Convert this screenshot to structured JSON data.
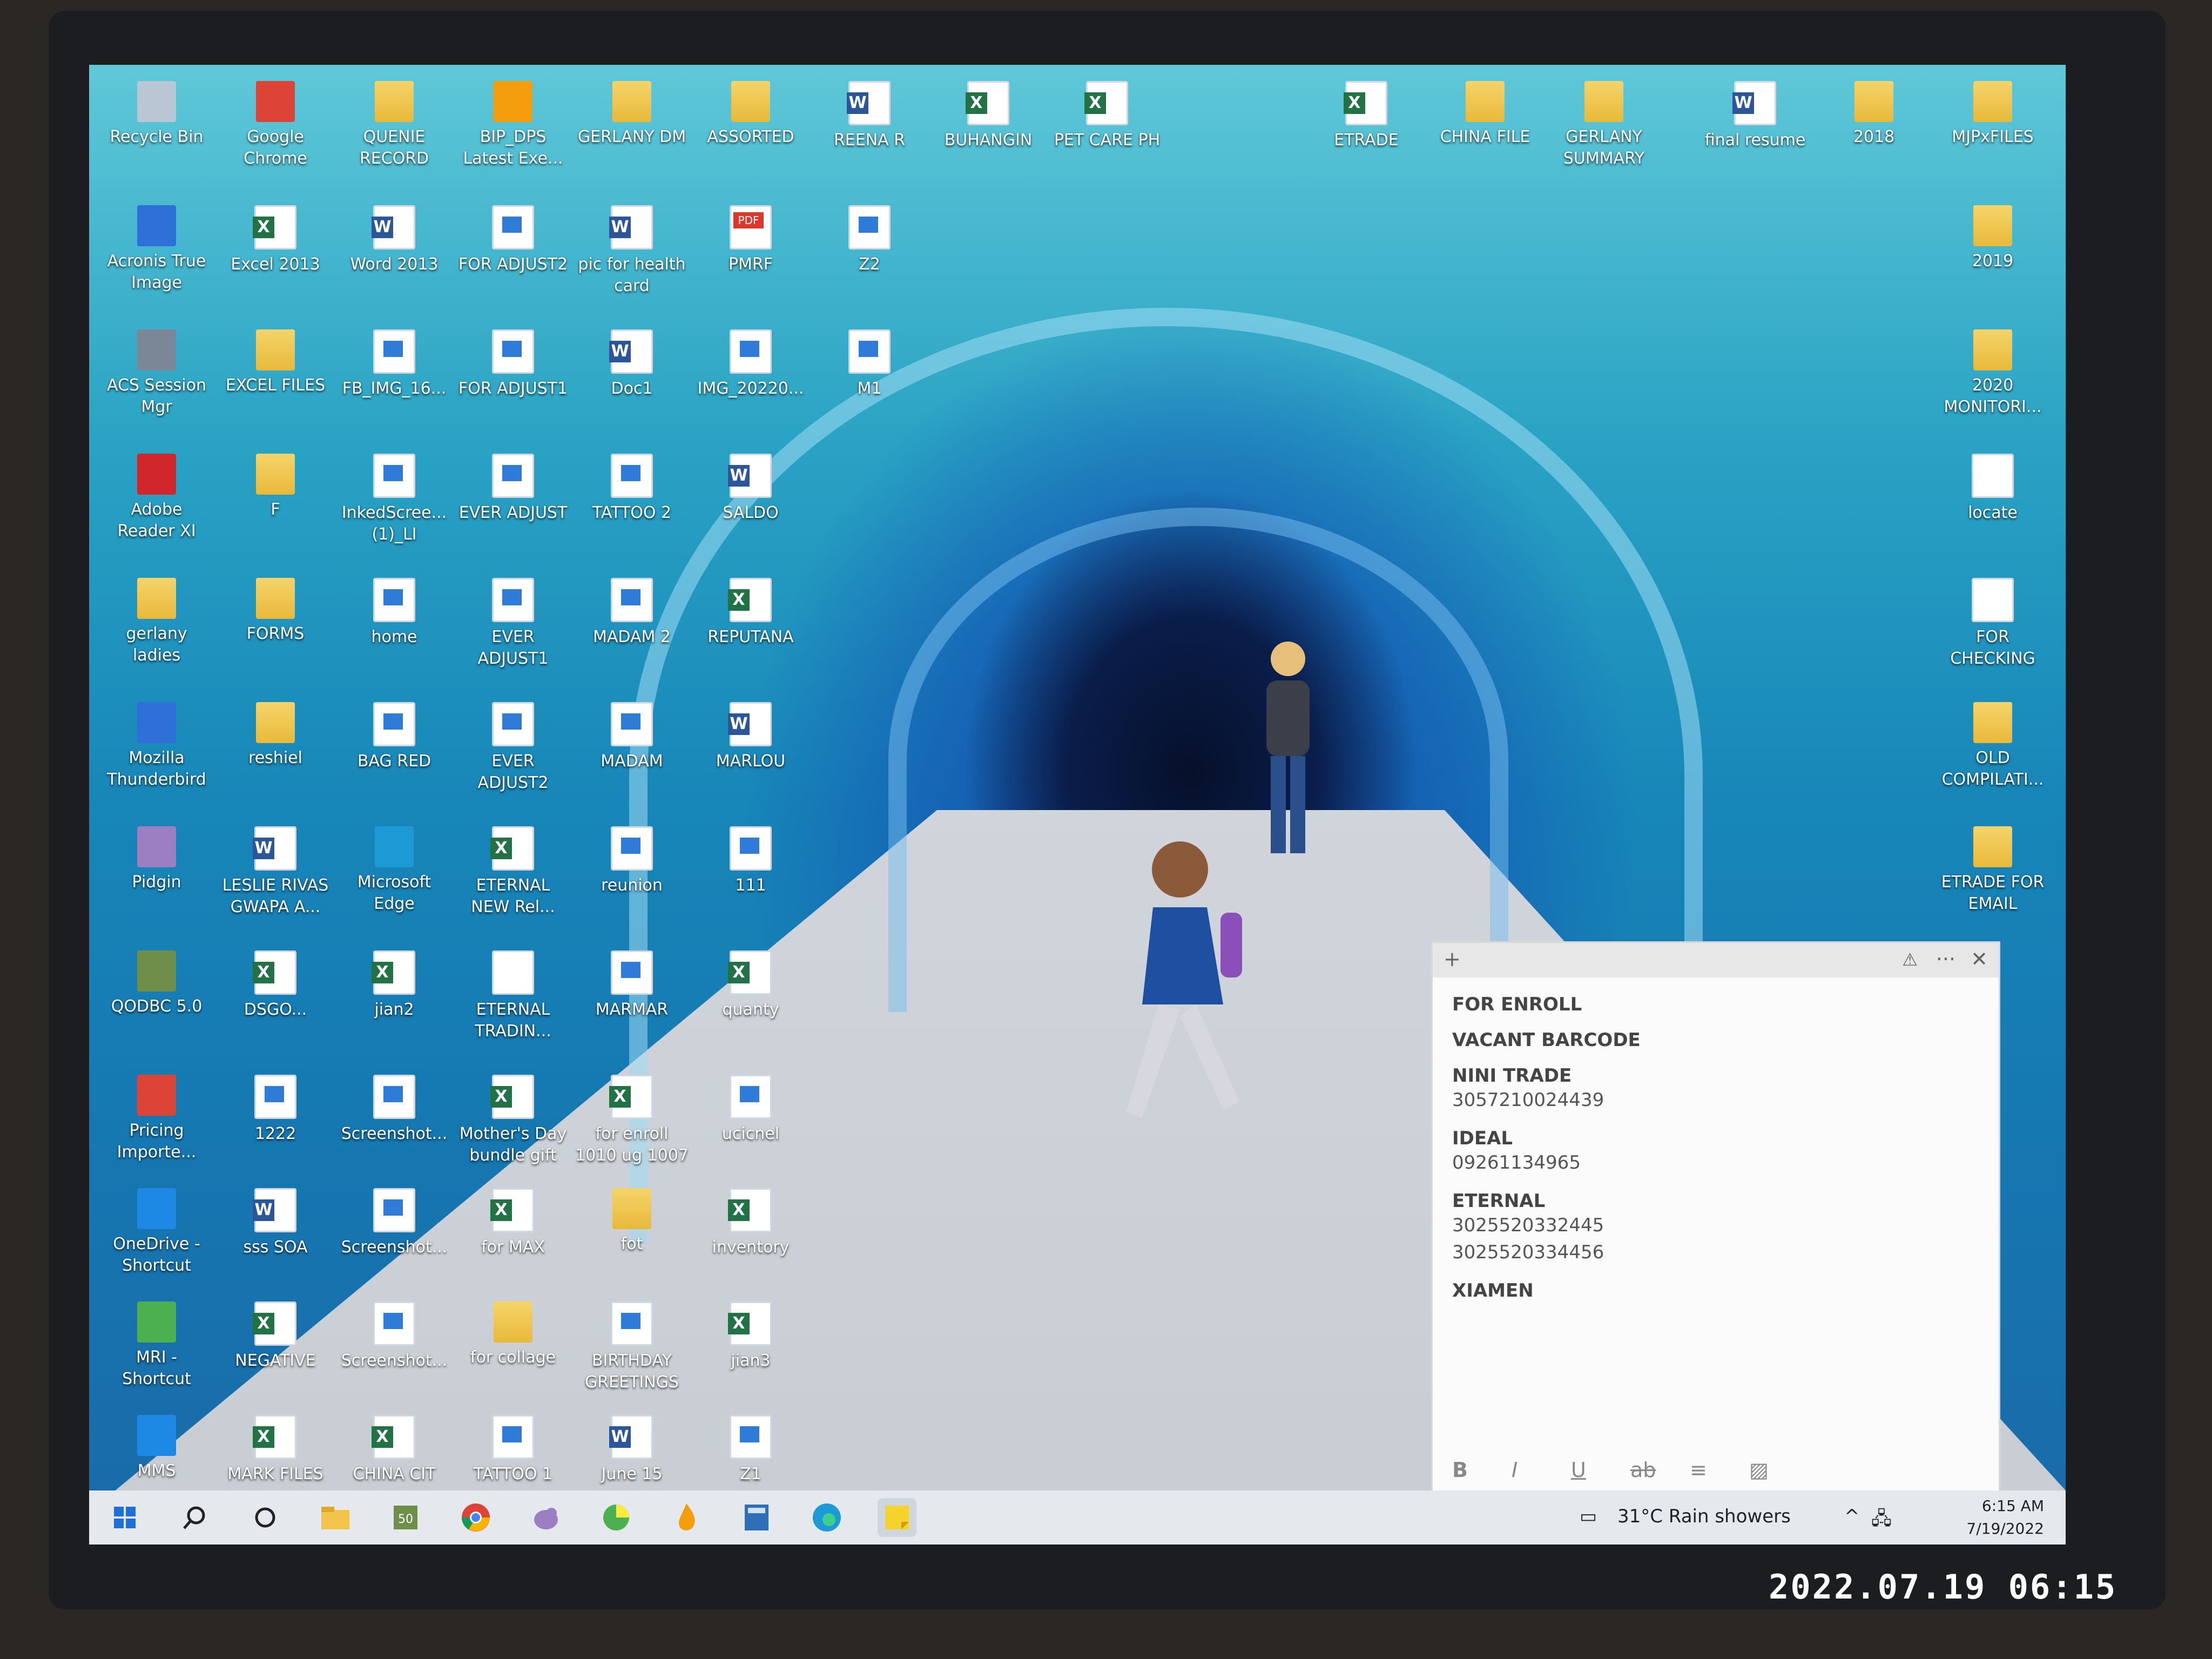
{
  "desktop": {
    "icons": [
      {
        "label": "Recycle Bin",
        "kind": "recycle"
      },
      {
        "label": "Google Chrome",
        "kind": "chrome"
      },
      {
        "label": "QUENIE RECORD",
        "kind": "folder"
      },
      {
        "label": "BIP_DPS Latest Exe...",
        "kind": "app-flame"
      },
      {
        "label": "GERLANY DM",
        "kind": "folder"
      },
      {
        "label": "ASSORTED",
        "kind": "folder"
      },
      {
        "label": "REENA R",
        "kind": "word"
      },
      {
        "label": "BUHANGIN",
        "kind": "excel"
      },
      {
        "label": "PET CARE PH",
        "kind": "excel"
      },
      {
        "label": "ETRADE",
        "kind": "excel"
      },
      {
        "label": "CHINA FILE",
        "kind": "folder"
      },
      {
        "label": "GERLANY SUMMARY",
        "kind": "folder"
      },
      {
        "label": "final resume",
        "kind": "word"
      },
      {
        "label": "2018",
        "kind": "folder"
      },
      {
        "label": "MJPxFILES",
        "kind": "folder"
      },
      {
        "label": "Acronis True Image",
        "kind": "app-acronis"
      },
      {
        "label": "Excel 2013",
        "kind": "excel"
      },
      {
        "label": "Word 2013",
        "kind": "word"
      },
      {
        "label": "FOR ADJUST2",
        "kind": "doc"
      },
      {
        "label": "pic for health card",
        "kind": "word"
      },
      {
        "label": "PMRF",
        "kind": "pdf"
      },
      {
        "label": "Z2",
        "kind": "doc"
      },
      {
        "label": "2019",
        "kind": "folder"
      },
      {
        "label": "ACS Session Mgr",
        "kind": "app-acs"
      },
      {
        "label": "EXCEL FILES",
        "kind": "folder"
      },
      {
        "label": "FB_IMG_16...",
        "kind": "doc"
      },
      {
        "label": "FOR ADJUST1",
        "kind": "doc"
      },
      {
        "label": "Doc1",
        "kind": "word"
      },
      {
        "label": "IMG_20220...",
        "kind": "doc"
      },
      {
        "label": "M1",
        "kind": "doc"
      },
      {
        "label": "2020 MONITORI...",
        "kind": "folder"
      },
      {
        "label": "Adobe Reader XI",
        "kind": "app-adobe"
      },
      {
        "label": "F",
        "kind": "folder"
      },
      {
        "label": "InkedScree... (1)_LI",
        "kind": "doc"
      },
      {
        "label": "EVER ADJUST",
        "kind": "doc"
      },
      {
        "label": "TATTOO 2",
        "kind": "doc"
      },
      {
        "label": "SALDO",
        "kind": "word"
      },
      {
        "label": "locate",
        "kind": "text"
      },
      {
        "label": "gerlany ladies",
        "kind": "folder"
      },
      {
        "label": "FORMS",
        "kind": "folder"
      },
      {
        "label": "home",
        "kind": "doc"
      },
      {
        "label": "EVER ADJUST1",
        "kind": "doc"
      },
      {
        "label": "MADAM 2",
        "kind": "doc"
      },
      {
        "label": "REPUTANA",
        "kind": "excel"
      },
      {
        "label": "FOR CHECKING",
        "kind": "text"
      },
      {
        "label": "Mozilla Thunderbird",
        "kind": "app-thunderbird"
      },
      {
        "label": "reshiel",
        "kind": "folder"
      },
      {
        "label": "BAG RED",
        "kind": "doc"
      },
      {
        "label": "EVER ADJUST2",
        "kind": "doc"
      },
      {
        "label": "MADAM",
        "kind": "doc"
      },
      {
        "label": "MARLOU",
        "kind": "word"
      },
      {
        "label": "OLD COMPILATI...",
        "kind": "folder"
      },
      {
        "label": "Pidgin",
        "kind": "app-pidgin"
      },
      {
        "label": "LESLIE RIVAS GWAPA A...",
        "kind": "word"
      },
      {
        "label": "Microsoft Edge",
        "kind": "app-edge"
      },
      {
        "label": "ETERNAL NEW Rel...",
        "kind": "excel"
      },
      {
        "label": "reunion",
        "kind": "doc"
      },
      {
        "label": "111",
        "kind": "doc"
      },
      {
        "label": "ETRADE FOR EMAIL",
        "kind": "folder"
      },
      {
        "label": "QODBC 5.0",
        "kind": "app-qodbc"
      },
      {
        "label": "DSGO...",
        "kind": "excel"
      },
      {
        "label": "jian2",
        "kind": "excel"
      },
      {
        "label": "ETERNAL TRADIN...",
        "kind": "text"
      },
      {
        "label": "MARMAR",
        "kind": "doc"
      },
      {
        "label": "quanty",
        "kind": "excel"
      },
      {
        "label": "Pricing Importe...",
        "kind": "chrome"
      },
      {
        "label": "1222",
        "kind": "doc"
      },
      {
        "label": "Screenshot...",
        "kind": "doc"
      },
      {
        "label": "Mother's Day bundle gift",
        "kind": "excel"
      },
      {
        "label": "for enroll 1010 ug 1007",
        "kind": "excel"
      },
      {
        "label": "ucicnel",
        "kind": "doc"
      },
      {
        "label": "OneDrive - Shortcut",
        "kind": "app-onedrive"
      },
      {
        "label": "sss SOA",
        "kind": "word"
      },
      {
        "label": "Screenshot...",
        "kind": "doc"
      },
      {
        "label": "for MAX",
        "kind": "excel"
      },
      {
        "label": "fot",
        "kind": "folder"
      },
      {
        "label": "inventory",
        "kind": "excel"
      },
      {
        "label": "MRI - Shortcut",
        "kind": "app-mri"
      },
      {
        "label": "NEGATIVE",
        "kind": "excel"
      },
      {
        "label": "Screenshot...",
        "kind": "doc"
      },
      {
        "label": "for collage",
        "kind": "folder"
      },
      {
        "label": "BIRTHDAY GREETINGS",
        "kind": "doc"
      },
      {
        "label": "jian3",
        "kind": "excel"
      },
      {
        "label": "MMS",
        "kind": "app-mms"
      },
      {
        "label": "MARK FILES",
        "kind": "excel"
      },
      {
        "label": "CHINA CIT",
        "kind": "excel"
      },
      {
        "label": "TATTOO 1",
        "kind": "doc"
      },
      {
        "label": "June 15",
        "kind": "word"
      },
      {
        "label": "Z1",
        "kind": "doc"
      }
    ]
  },
  "sticky_note": {
    "items": [
      {
        "name": "FOR ENROLL",
        "values": []
      },
      {
        "name": "VACANT BARCODE",
        "values": []
      },
      {
        "name": "NINI TRADE",
        "values": [
          "3057210024439"
        ]
      },
      {
        "name": "IDEAL",
        "values": [
          "09261134965"
        ]
      },
      {
        "name": "ETERNAL",
        "values": [
          "3025520332445",
          "3025520334456"
        ]
      },
      {
        "name": "XIAMEN",
        "values": []
      }
    ],
    "toolbar": {
      "add": "+",
      "warning": "⚠",
      "more": "···",
      "close": "✕"
    },
    "format": {
      "bold": "B",
      "italic": "I",
      "underline": "U",
      "strike": "ab",
      "list": "≡",
      "image": "▨"
    }
  },
  "taskbar": {
    "weather": "31°C  Rain showers",
    "time": "6:15 AM",
    "date": "7/19/2022",
    "chevron": "^"
  },
  "photo_stamp": "2022.07.19 06:15",
  "colors": {
    "water": "#1786b8",
    "taskbar": "#e5e8ec",
    "sticky": "#fbfbfb",
    "folder": "#e8b93a",
    "word": "#2b579a",
    "excel": "#217346"
  }
}
